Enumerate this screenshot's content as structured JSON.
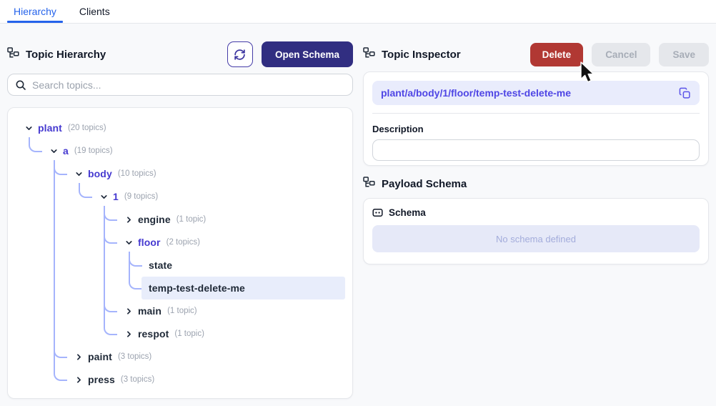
{
  "tabs": {
    "items": [
      {
        "label": "Hierarchy",
        "active": true
      },
      {
        "label": "Clients",
        "active": false
      }
    ]
  },
  "left_panel": {
    "title": "Topic Hierarchy",
    "open_schema_label": "Open Schema",
    "search_placeholder": "Search topics...",
    "tree": [
      {
        "name": "plant",
        "count": "(20 topics)",
        "state": "expanded",
        "children": [
          {
            "name": "a",
            "count": "(19 topics)",
            "state": "expanded",
            "children": [
              {
                "name": "body",
                "count": "(10 topics)",
                "state": "expanded",
                "children": [
                  {
                    "name": "1",
                    "count": "(9 topics)",
                    "state": "expanded",
                    "children": [
                      {
                        "name": "engine",
                        "count": "(1 topic)",
                        "state": "collapsed"
                      },
                      {
                        "name": "floor",
                        "count": "(2 topics)",
                        "state": "expanded",
                        "children": [
                          {
                            "name": "state",
                            "state": "leaf"
                          },
                          {
                            "name": "temp-test-delete-me",
                            "state": "leaf",
                            "selected": true
                          }
                        ]
                      },
                      {
                        "name": "main",
                        "count": "(1 topic)",
                        "state": "collapsed"
                      },
                      {
                        "name": "respot",
                        "count": "(1 topic)",
                        "state": "collapsed"
                      }
                    ]
                  }
                ]
              },
              {
                "name": "paint",
                "count": "(3 topics)",
                "state": "collapsed"
              },
              {
                "name": "press",
                "count": "(3 topics)",
                "state": "collapsed"
              }
            ]
          }
        ]
      }
    ]
  },
  "right_panel": {
    "title": "Topic Inspector",
    "delete_label": "Delete",
    "cancel_label": "Cancel",
    "save_label": "Save",
    "topic_path": "plant/a/body/1/floor/temp-test-delete-me",
    "description_label": "Description",
    "description_value": "",
    "payload_schema_title": "Payload Schema",
    "schema_label": "Schema",
    "schema_empty_text": "No schema defined"
  },
  "colors": {
    "tab_active_blue": "#2563eb",
    "node_expanded_indigo": "#4539d0",
    "node_default": "#1f2937",
    "connector_line": "#a5b4fc",
    "selected_row_bg": "#e8edfb",
    "open_schema_bg": "#312e81",
    "delete_bg": "#b13833",
    "muted_button_bg": "#e5e7eb",
    "chip_bg": "#e9ecfc",
    "chip_text": "#4f46e5",
    "schema_empty_bg": "#e6e9f8",
    "schema_empty_text": "#a3acdb"
  }
}
